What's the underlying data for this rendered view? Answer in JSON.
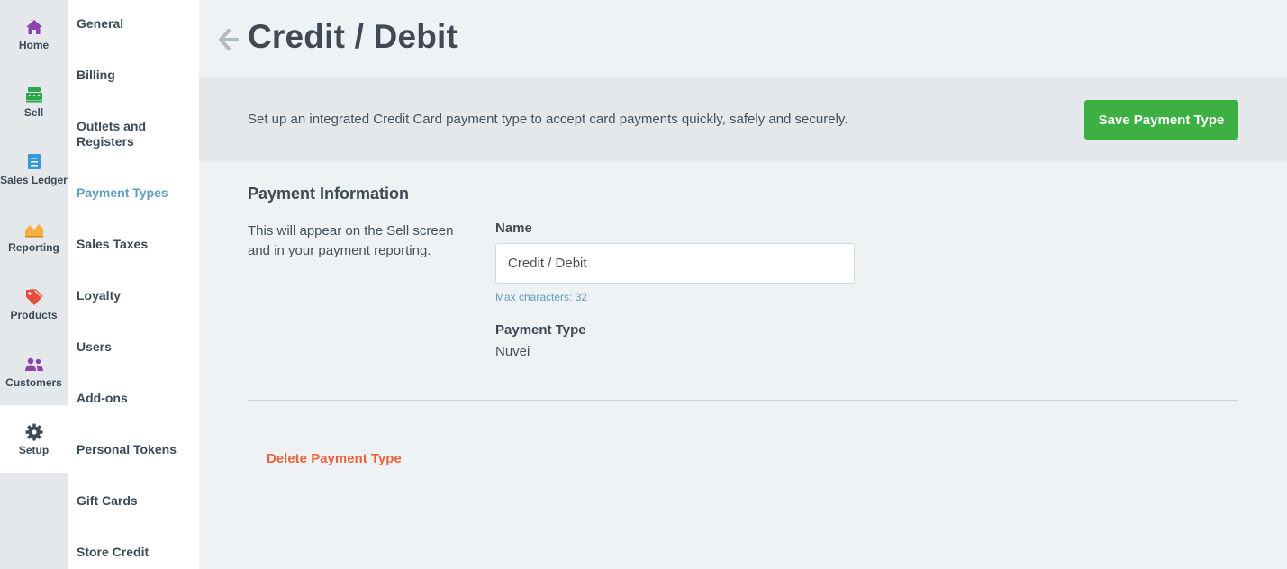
{
  "nav": {
    "items": [
      {
        "label": "Home",
        "icon": "home-icon",
        "color": "#8e44ad"
      },
      {
        "label": "Sell",
        "icon": "register-icon",
        "color": "#2ea84f"
      },
      {
        "label": "Sales Ledger",
        "icon": "ledger-icon",
        "color": "#3498db"
      },
      {
        "label": "Reporting",
        "icon": "chart-icon",
        "color": "#f5b041"
      },
      {
        "label": "Products",
        "icon": "tag-icon",
        "color": "#e74c3c"
      },
      {
        "label": "Customers",
        "icon": "customers-icon",
        "color": "#8e44ad"
      },
      {
        "label": "Setup",
        "icon": "gear-icon",
        "color": "#3a4a58"
      }
    ],
    "active": "Setup"
  },
  "submenu": {
    "items": [
      {
        "label": "General"
      },
      {
        "label": "Billing"
      },
      {
        "label": "Outlets and Registers"
      },
      {
        "label": "Payment Types"
      },
      {
        "label": "Sales Taxes"
      },
      {
        "label": "Loyalty"
      },
      {
        "label": "Users"
      },
      {
        "label": "Add-ons"
      },
      {
        "label": "Personal Tokens"
      },
      {
        "label": "Gift Cards"
      },
      {
        "label": "Store Credit"
      }
    ],
    "active": "Payment Types"
  },
  "header": {
    "title": "Credit / Debit"
  },
  "banner": {
    "text": "Set up an integrated Credit Card payment type to accept card payments quickly, safely and securely.",
    "save_label": "Save Payment Type"
  },
  "section": {
    "title": "Payment Information",
    "description": "This will appear on the Sell screen and in your payment reporting."
  },
  "form": {
    "name_label": "Name",
    "name_value": "Credit / Debit",
    "name_hint": "Max characters: 32",
    "payment_type_label": "Payment Type",
    "payment_type_value": "Nuvei"
  },
  "actions": {
    "delete_label": "Delete Payment Type"
  },
  "colors": {
    "accent_green": "#3cb042",
    "link_blue": "#5f9ec2",
    "danger_orange": "#e8643a"
  }
}
